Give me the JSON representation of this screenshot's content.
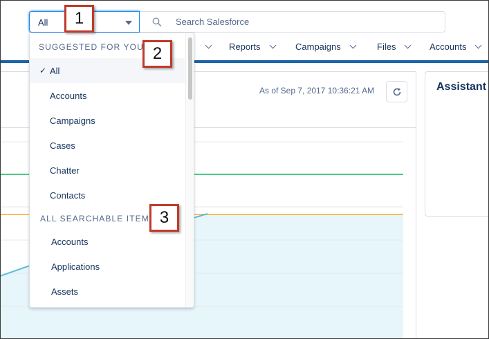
{
  "search": {
    "scope_value": "All",
    "placeholder": "Search Salesforce"
  },
  "nav": {
    "items": [
      "Reports",
      "Campaigns",
      "Files",
      "Accounts"
    ]
  },
  "dashboard": {
    "as_of": "As of Sep 7, 2017 10:36:21 AM",
    "refresh_icon": "refresh-icon"
  },
  "assistant": {
    "title": "Assistant"
  },
  "dropdown": {
    "suggested_heading": "SUGGESTED FOR YOU",
    "suggested_items": [
      "All",
      "Accounts",
      "Campaigns",
      "Cases",
      "Chatter",
      "Contacts"
    ],
    "selected": "All",
    "searchable_heading": "ALL SEARCHABLE ITEMS",
    "searchable_items": [
      "Accounts",
      "Applications",
      "Assets"
    ]
  },
  "callouts": [
    "1",
    "2",
    "3"
  ],
  "colors": {
    "brand_line": "#1a63a8",
    "green_line": "#4bca81",
    "orange_line": "#f9a825",
    "teal_line": "#5dbdd8",
    "area_fill": "#e6f6fa",
    "callout_border": "#c0392b"
  }
}
